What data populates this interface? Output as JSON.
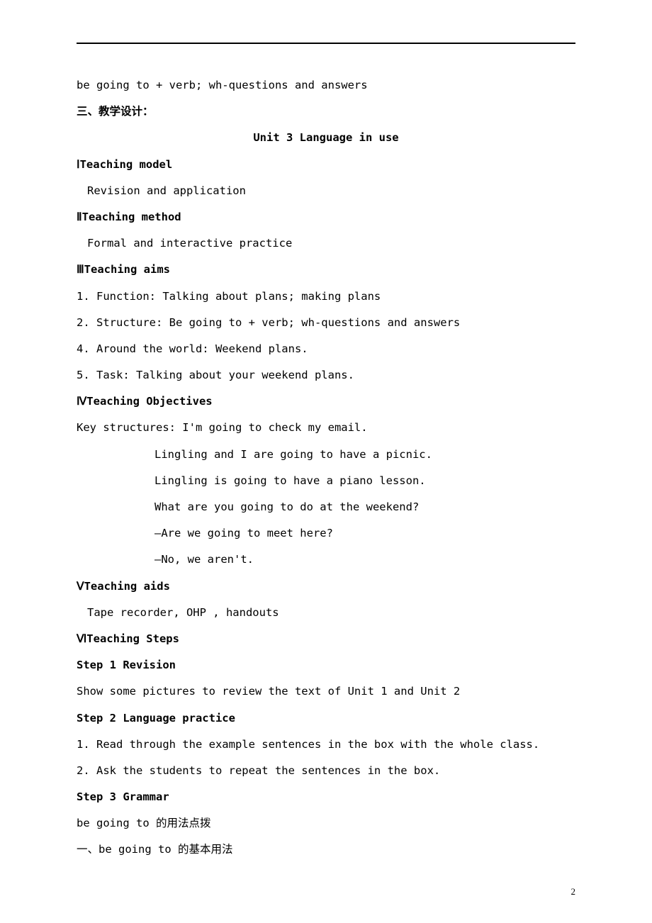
{
  "line_top": "be going to + verb; wh-questions and answers",
  "section3_heading": "三、教学设计：",
  "unit_title": "Unit 3 Language in use",
  "s1": {
    "heading": "ⅠTeaching model",
    "body": "Revision and application"
  },
  "s2": {
    "heading": "ⅡTeaching method",
    "body": "Formal and interactive practice"
  },
  "s3": {
    "heading": "ⅢTeaching aims",
    "items": [
      "1. Function: Talking about plans; making plans",
      "2. Structure: Be going to + verb; wh-questions and answers",
      "4. Around the world: Weekend plans.",
      "5. Task: Talking about your weekend plans."
    ]
  },
  "s4": {
    "heading": "ⅣTeaching Objectives",
    "lead": "Key structures: I'm going to check my email.",
    "lines": [
      "Lingling and I are going to have a picnic.",
      "Lingling is going to have a piano lesson.",
      "What are you going to do at the weekend?",
      "—Are we going to meet here?",
      "—No, we aren't."
    ]
  },
  "s5": {
    "heading": "ⅤTeaching aids",
    "body": "Tape recorder, OHP , handouts"
  },
  "s6": {
    "heading": "ⅥTeaching Steps",
    "steps": [
      {
        "title": "Step 1 Revision",
        "lines": [
          "Show some pictures to review the text of Unit 1 and Unit 2"
        ]
      },
      {
        "title": "Step 2 Language practice",
        "lines": [
          "1. Read through the example sentences in the box with the whole class.",
          "2. Ask the students to repeat the sentences in the box."
        ]
      },
      {
        "title": "Step 3 Grammar",
        "lines": [
          "be going to 的用法点拨",
          "一、be going to 的基本用法"
        ]
      }
    ]
  },
  "page_number": "2"
}
